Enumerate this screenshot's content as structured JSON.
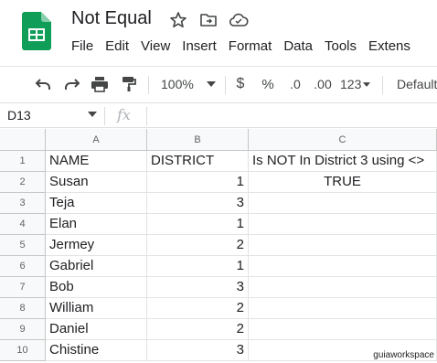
{
  "app": {
    "title": "Not Equal",
    "menu": [
      "File",
      "Edit",
      "View",
      "Insert",
      "Format",
      "Data",
      "Tools",
      "Extens"
    ]
  },
  "toolbar": {
    "zoom": "100%",
    "currency": "$",
    "percent": "%",
    "decrease_decimal": ".0",
    "increase_decimal": ".00",
    "number_format": "123",
    "font": "Default"
  },
  "formula_bar": {
    "name_box": "D13",
    "fx": "fx",
    "formula": ""
  },
  "sheet": {
    "columns": [
      "A",
      "B",
      "C"
    ],
    "rows": [
      {
        "num": "1",
        "a": "NAME",
        "b": "DISTRICT",
        "c": "Is NOT In District 3 using <>"
      },
      {
        "num": "2",
        "a": "Susan",
        "b": "1",
        "c": "TRUE"
      },
      {
        "num": "3",
        "a": "Teja",
        "b": "3",
        "c": ""
      },
      {
        "num": "4",
        "a": "Elan",
        "b": "1",
        "c": ""
      },
      {
        "num": "5",
        "a": "Jermey",
        "b": "2",
        "c": ""
      },
      {
        "num": "6",
        "a": "Gabriel",
        "b": "1",
        "c": ""
      },
      {
        "num": "7",
        "a": "Bob",
        "b": "3",
        "c": ""
      },
      {
        "num": "8",
        "a": "William",
        "b": "2",
        "c": ""
      },
      {
        "num": "9",
        "a": "Daniel",
        "b": "2",
        "c": ""
      },
      {
        "num": "10",
        "a": "Chistine",
        "b": "3",
        "c": ""
      }
    ]
  },
  "watermark": "guiaworkspace",
  "colors": {
    "sheets_green": "#0f9d58",
    "header_bg": "#f8f9fa",
    "gridline": "#e2e3e3"
  }
}
